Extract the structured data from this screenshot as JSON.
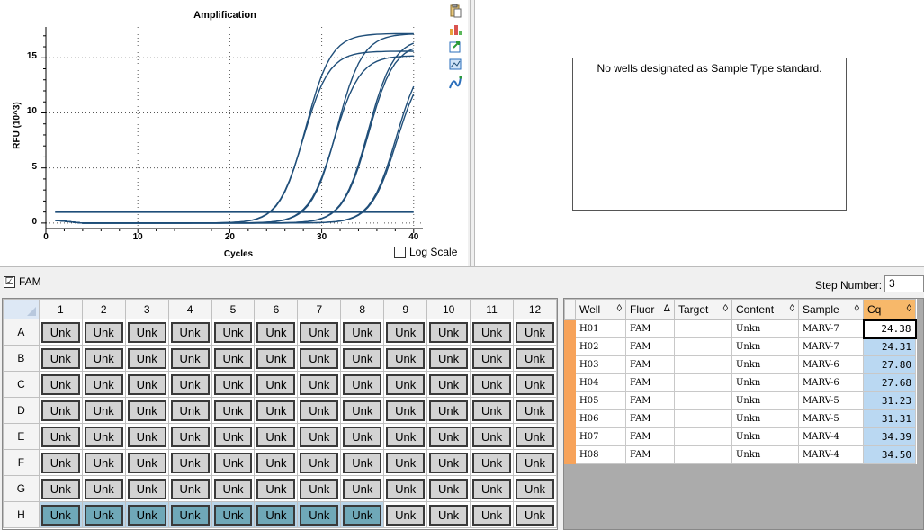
{
  "chart": {
    "title": "Amplification",
    "xlabel": "Cycles",
    "ylabel": "RFU (10^3)",
    "log_scale_label": "Log Scale",
    "tools": [
      "clipboard-icon",
      "chart-properties-icon",
      "export-icon",
      "zoom-icon",
      "trace-icon"
    ]
  },
  "chart_data": {
    "type": "line",
    "title": "Amplification",
    "xlabel": "Cycles",
    "ylabel": "RFU (10^3)",
    "xlim": [
      0,
      41
    ],
    "ylim": [
      -0.5,
      17.8
    ],
    "x_ticks": [
      0,
      10,
      20,
      30,
      40
    ],
    "y_ticks": [
      0,
      5,
      10,
      15
    ],
    "grid": "dotted",
    "threshold": 1.0,
    "series": [
      {
        "cq": 24.38,
        "plateau": 17.2
      },
      {
        "cq": 24.31,
        "plateau": 15.6
      },
      {
        "cq": 27.8,
        "plateau": 17.2
      },
      {
        "cq": 27.68,
        "plateau": 15.2
      },
      {
        "cq": 31.23,
        "plateau": 16.8
      },
      {
        "cq": 31.31,
        "plateau": 16.3
      },
      {
        "cq": 34.39,
        "plateau": 15.6
      },
      {
        "cq": 34.5,
        "plateau": 14.8
      }
    ],
    "color": "#1f4e79"
  },
  "standard": {
    "message": "No wells designated as Sample Type standard."
  },
  "strip": {
    "fam_label": "FAM",
    "fam_checked": "☑",
    "step_label": "Step Number:",
    "step_value": "3"
  },
  "plate": {
    "columns": [
      "1",
      "2",
      "3",
      "4",
      "5",
      "6",
      "7",
      "8",
      "9",
      "10",
      "11",
      "12"
    ],
    "rows": [
      "A",
      "B",
      "C",
      "D",
      "E",
      "F",
      "G",
      "H"
    ],
    "cell_label": "Unk",
    "selected_row": "H",
    "selected_cols": [
      "1",
      "2",
      "3",
      "4",
      "5",
      "6",
      "7",
      "8"
    ]
  },
  "results": {
    "headers": [
      {
        "label": "Well",
        "sort": "◊"
      },
      {
        "label": "Fluor",
        "sort": "Δ"
      },
      {
        "label": "Target",
        "sort": "◊"
      },
      {
        "label": "Content",
        "sort": "◊"
      },
      {
        "label": "Sample",
        "sort": "◊"
      },
      {
        "label": "Cq",
        "sort": "◊"
      }
    ],
    "rows": [
      {
        "well": "H01",
        "fluor": "FAM",
        "target": "",
        "content": "Unkn",
        "sample": "MARV-7",
        "cq": "24.38"
      },
      {
        "well": "H02",
        "fluor": "FAM",
        "target": "",
        "content": "Unkn",
        "sample": "MARV-7",
        "cq": "24.31"
      },
      {
        "well": "H03",
        "fluor": "FAM",
        "target": "",
        "content": "Unkn",
        "sample": "MARV-6",
        "cq": "27.80"
      },
      {
        "well": "H04",
        "fluor": "FAM",
        "target": "",
        "content": "Unkn",
        "sample": "MARV-6",
        "cq": "27.68"
      },
      {
        "well": "H05",
        "fluor": "FAM",
        "target": "",
        "content": "Unkn",
        "sample": "MARV-5",
        "cq": "31.23"
      },
      {
        "well": "H06",
        "fluor": "FAM",
        "target": "",
        "content": "Unkn",
        "sample": "MARV-5",
        "cq": "31.31"
      },
      {
        "well": "H07",
        "fluor": "FAM",
        "target": "",
        "content": "Unkn",
        "sample": "MARV-4",
        "cq": "34.39"
      },
      {
        "well": "H08",
        "fluor": "FAM",
        "target": "",
        "content": "Unkn",
        "sample": "MARV-4",
        "cq": "34.50"
      }
    ]
  }
}
